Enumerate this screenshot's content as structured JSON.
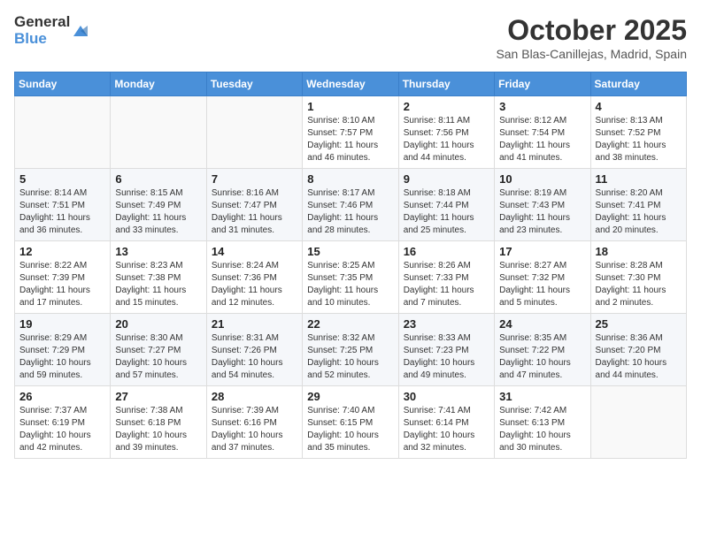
{
  "header": {
    "logo_general": "General",
    "logo_blue": "Blue",
    "month_title": "October 2025",
    "location": "San Blas-Canillejas, Madrid, Spain"
  },
  "calendar": {
    "days_of_week": [
      "Sunday",
      "Monday",
      "Tuesday",
      "Wednesday",
      "Thursday",
      "Friday",
      "Saturday"
    ],
    "weeks": [
      [
        {
          "day": "",
          "info": ""
        },
        {
          "day": "",
          "info": ""
        },
        {
          "day": "",
          "info": ""
        },
        {
          "day": "1",
          "info": "Sunrise: 8:10 AM\nSunset: 7:57 PM\nDaylight: 11 hours and 46 minutes."
        },
        {
          "day": "2",
          "info": "Sunrise: 8:11 AM\nSunset: 7:56 PM\nDaylight: 11 hours and 44 minutes."
        },
        {
          "day": "3",
          "info": "Sunrise: 8:12 AM\nSunset: 7:54 PM\nDaylight: 11 hours and 41 minutes."
        },
        {
          "day": "4",
          "info": "Sunrise: 8:13 AM\nSunset: 7:52 PM\nDaylight: 11 hours and 38 minutes."
        }
      ],
      [
        {
          "day": "5",
          "info": "Sunrise: 8:14 AM\nSunset: 7:51 PM\nDaylight: 11 hours and 36 minutes."
        },
        {
          "day": "6",
          "info": "Sunrise: 8:15 AM\nSunset: 7:49 PM\nDaylight: 11 hours and 33 minutes."
        },
        {
          "day": "7",
          "info": "Sunrise: 8:16 AM\nSunset: 7:47 PM\nDaylight: 11 hours and 31 minutes."
        },
        {
          "day": "8",
          "info": "Sunrise: 8:17 AM\nSunset: 7:46 PM\nDaylight: 11 hours and 28 minutes."
        },
        {
          "day": "9",
          "info": "Sunrise: 8:18 AM\nSunset: 7:44 PM\nDaylight: 11 hours and 25 minutes."
        },
        {
          "day": "10",
          "info": "Sunrise: 8:19 AM\nSunset: 7:43 PM\nDaylight: 11 hours and 23 minutes."
        },
        {
          "day": "11",
          "info": "Sunrise: 8:20 AM\nSunset: 7:41 PM\nDaylight: 11 hours and 20 minutes."
        }
      ],
      [
        {
          "day": "12",
          "info": "Sunrise: 8:22 AM\nSunset: 7:39 PM\nDaylight: 11 hours and 17 minutes."
        },
        {
          "day": "13",
          "info": "Sunrise: 8:23 AM\nSunset: 7:38 PM\nDaylight: 11 hours and 15 minutes."
        },
        {
          "day": "14",
          "info": "Sunrise: 8:24 AM\nSunset: 7:36 PM\nDaylight: 11 hours and 12 minutes."
        },
        {
          "day": "15",
          "info": "Sunrise: 8:25 AM\nSunset: 7:35 PM\nDaylight: 11 hours and 10 minutes."
        },
        {
          "day": "16",
          "info": "Sunrise: 8:26 AM\nSunset: 7:33 PM\nDaylight: 11 hours and 7 minutes."
        },
        {
          "day": "17",
          "info": "Sunrise: 8:27 AM\nSunset: 7:32 PM\nDaylight: 11 hours and 5 minutes."
        },
        {
          "day": "18",
          "info": "Sunrise: 8:28 AM\nSunset: 7:30 PM\nDaylight: 11 hours and 2 minutes."
        }
      ],
      [
        {
          "day": "19",
          "info": "Sunrise: 8:29 AM\nSunset: 7:29 PM\nDaylight: 10 hours and 59 minutes."
        },
        {
          "day": "20",
          "info": "Sunrise: 8:30 AM\nSunset: 7:27 PM\nDaylight: 10 hours and 57 minutes."
        },
        {
          "day": "21",
          "info": "Sunrise: 8:31 AM\nSunset: 7:26 PM\nDaylight: 10 hours and 54 minutes."
        },
        {
          "day": "22",
          "info": "Sunrise: 8:32 AM\nSunset: 7:25 PM\nDaylight: 10 hours and 52 minutes."
        },
        {
          "day": "23",
          "info": "Sunrise: 8:33 AM\nSunset: 7:23 PM\nDaylight: 10 hours and 49 minutes."
        },
        {
          "day": "24",
          "info": "Sunrise: 8:35 AM\nSunset: 7:22 PM\nDaylight: 10 hours and 47 minutes."
        },
        {
          "day": "25",
          "info": "Sunrise: 8:36 AM\nSunset: 7:20 PM\nDaylight: 10 hours and 44 minutes."
        }
      ],
      [
        {
          "day": "26",
          "info": "Sunrise: 7:37 AM\nSunset: 6:19 PM\nDaylight: 10 hours and 42 minutes."
        },
        {
          "day": "27",
          "info": "Sunrise: 7:38 AM\nSunset: 6:18 PM\nDaylight: 10 hours and 39 minutes."
        },
        {
          "day": "28",
          "info": "Sunrise: 7:39 AM\nSunset: 6:16 PM\nDaylight: 10 hours and 37 minutes."
        },
        {
          "day": "29",
          "info": "Sunrise: 7:40 AM\nSunset: 6:15 PM\nDaylight: 10 hours and 35 minutes."
        },
        {
          "day": "30",
          "info": "Sunrise: 7:41 AM\nSunset: 6:14 PM\nDaylight: 10 hours and 32 minutes."
        },
        {
          "day": "31",
          "info": "Sunrise: 7:42 AM\nSunset: 6:13 PM\nDaylight: 10 hours and 30 minutes."
        },
        {
          "day": "",
          "info": ""
        }
      ]
    ]
  }
}
